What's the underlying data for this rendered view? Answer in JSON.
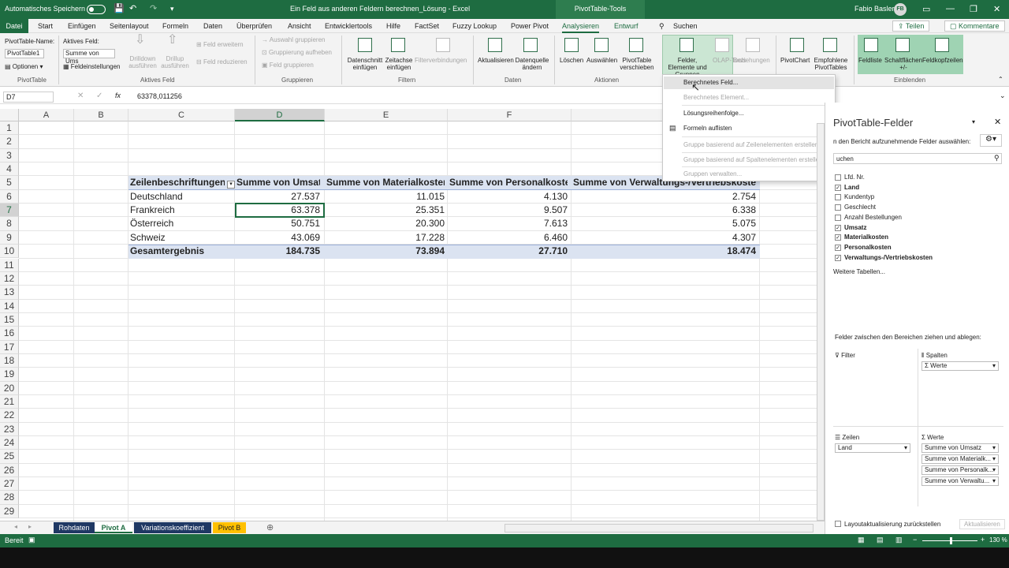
{
  "titlebar": {
    "autosave": "Automatisches Speichern",
    "doc_title": "Ein Feld aus anderen Feldern berechnen_Lösung  -  Excel",
    "context_tab": "PivotTable-Tools",
    "user": "Fabio Basler",
    "initials": "FB"
  },
  "menu": {
    "file": "Datei",
    "items": [
      "Start",
      "Einfügen",
      "Seitenlayout",
      "Formeln",
      "Daten",
      "Überprüfen",
      "Ansicht",
      "Entwicklertools",
      "Hilfe",
      "FactSet",
      "Fuzzy Lookup",
      "Power Pivot"
    ],
    "active": "Analysieren",
    "design": "Entwurf",
    "search": "Suchen",
    "share": "Teilen",
    "comments": "Kommentare"
  },
  "ribbon": {
    "pt_name_label": "PivotTable-Name:",
    "pt_name": "PivotTable1",
    "options": "Optionen",
    "group_pivottable": "PivotTable",
    "active_field_label": "Aktives Feld:",
    "active_field": "Summe von Ums",
    "field_settings": "Feldeinstellungen",
    "drilldown": "Drilldown ausführen",
    "drillup": "Drillup ausführen",
    "expand_field": "Feld erweitern",
    "collapse_field": "Feld reduzieren",
    "group_active": "Aktives Feld",
    "group_selection": "Auswahl gruppieren",
    "ungroup": "Gruppierung aufheben",
    "group_field": "Feld gruppieren",
    "group_group": "Gruppieren",
    "insert_slicer": "Datenschnitt einfügen",
    "insert_timeline": "Zeitachse einfügen",
    "filter_connections": "Filterverbindungen",
    "group_filter": "Filtern",
    "refresh": "Aktualisieren",
    "change_source": "Datenquelle ändern",
    "group_data": "Daten",
    "clear": "Löschen",
    "select": "Auswählen",
    "move_pt": "PivotTable verschieben",
    "group_actions": "Aktionen",
    "fields_items": "Felder, Elemente und Gruppen",
    "olap": "OLAP-Tools",
    "relationships": "Beziehungen",
    "pivotchart": "PivotChart",
    "recommended": "Empfohlene PivotTables",
    "field_list": "Feldliste",
    "buttons": "Schaltflächen +/-",
    "headers": "Feldkopfzeilen",
    "group_show": "Einblenden"
  },
  "formula": {
    "name_box": "D7",
    "value": "63378,011256"
  },
  "columns": [
    "A",
    "B",
    "C",
    "D",
    "E",
    "F",
    "G"
  ],
  "rows": [
    "1",
    "2",
    "3",
    "4",
    "5",
    "6",
    "7",
    "8",
    "9",
    "10",
    "11",
    "12",
    "13",
    "14",
    "15",
    "16",
    "17",
    "18",
    "19",
    "20",
    "21",
    "22",
    "23",
    "24",
    "25",
    "26",
    "27",
    "28",
    "29"
  ],
  "pivot": {
    "headers": [
      "Zeilenbeschriftungen",
      "Summe von Umsatz",
      "Summe von Materialkosten",
      "Summe von Personalkosten",
      "Summe von Verwaltungs-/Vertriebskosten"
    ],
    "rows": [
      [
        "Deutschland",
        "27.537",
        "11.015",
        "4.130",
        "2.754"
      ],
      [
        "Frankreich",
        "63.378",
        "25.351",
        "9.507",
        "6.338"
      ],
      [
        "Österreich",
        "50.751",
        "20.300",
        "7.613",
        "5.075"
      ],
      [
        "Schweiz",
        "43.069",
        "17.228",
        "6.460",
        "4.307"
      ]
    ],
    "total": [
      "Gesamtergebnis",
      "184.735",
      "73.894",
      "27.710",
      "18.474"
    ]
  },
  "context_menu": {
    "items": [
      "Berechnetes Feld...",
      "Berechnetes Element...",
      "Lösungsreihenfolge...",
      "Formeln auflisten",
      "Gruppe basierend auf Zeilenelementen erstellen...",
      "Gruppe basierend auf Spaltenelementen erstellen...",
      "Gruppen verwalten..."
    ]
  },
  "pane": {
    "title": "PivotTable-Felder",
    "subtitle": "n den Bericht aufzunehmende Felder auswählen:",
    "search": "uchen",
    "fields": [
      {
        "name": "Lfd. Nr.",
        "checked": false
      },
      {
        "name": "Land",
        "checked": true
      },
      {
        "name": "Kundentyp",
        "checked": false
      },
      {
        "name": "Geschlecht",
        "checked": false
      },
      {
        "name": "Anzahl Bestellungen",
        "checked": false
      },
      {
        "name": "Umsatz",
        "checked": true
      },
      {
        "name": "Materialkosten",
        "checked": true
      },
      {
        "name": "Personalkosten",
        "checked": true
      },
      {
        "name": "Verwaltungs-/Vertriebskosten",
        "checked": true
      }
    ],
    "more_tables": "Weitere Tabellen...",
    "drag_hint": "Felder zwischen den Bereichen ziehen und ablegen:",
    "filter": "Filter",
    "columns": "Spalten",
    "columns_value": "Σ  Werte",
    "rows": "Zeilen",
    "rows_value": "Land",
    "values": "Werte",
    "value_items": [
      "Summe von Umsatz",
      "Summe von Materialk...",
      "Summe von Personalk...",
      "Summe von Verwaltu..."
    ],
    "defer": "Layoutaktualisierung zurückstellen",
    "update": "Aktualisieren"
  },
  "sheets": [
    "Rohdaten",
    "Pivot A",
    "Variationskoeffizient",
    "Pivot B"
  ],
  "status": {
    "ready": "Bereit",
    "zoom": "130 %"
  },
  "colors": {
    "excel_green": "#1e6c41",
    "tab_rohdaten": "#1f3864",
    "tab_variation": "#1f3864",
    "tab_pivotb": "#ffc000"
  }
}
